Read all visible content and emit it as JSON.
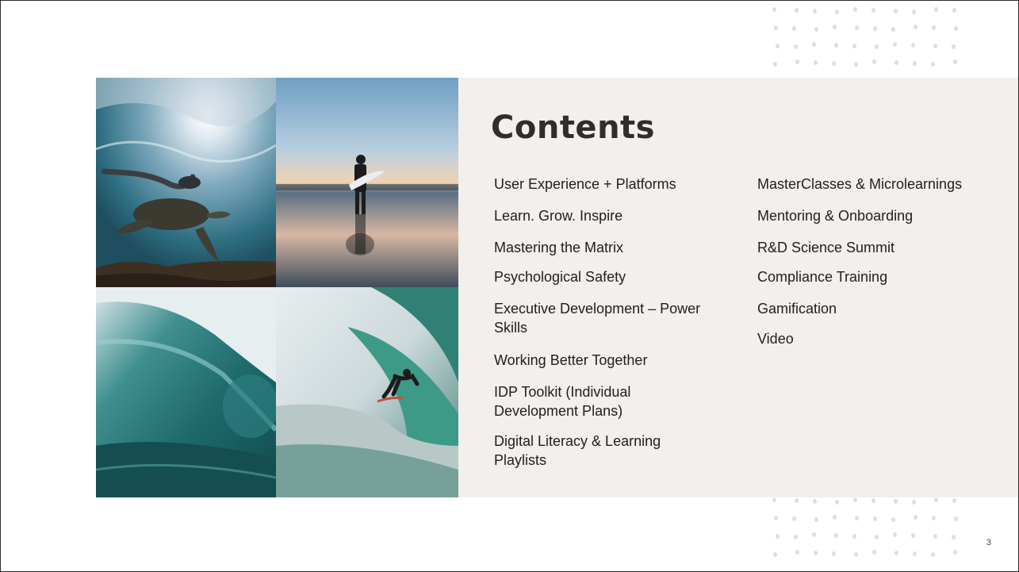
{
  "slide": {
    "title": "Contents",
    "page_number": "3",
    "contents_left": [
      "User Experience + Platforms",
      "Learn. Grow. Inspire",
      "Mastering the Matrix",
      "Psychological Safety",
      "Executive Development – Power Skills",
      "Working Better Together",
      "IDP Toolkit (Individual Development Plans)",
      "Digital Literacy & Learning Playlists"
    ],
    "contents_right": [
      "MasterClasses & Microlearnings",
      "Mentoring & Onboarding",
      "R&D Science Summit",
      "Compliance Training",
      "Gamification",
      "Video"
    ],
    "photos": [
      {
        "name": "underwater-turtle-diver-photo",
        "icon": "turtle-photo"
      },
      {
        "name": "surfer-on-beach-photo",
        "icon": "surfer-silhouette-photo"
      },
      {
        "name": "ocean-wave-photo",
        "icon": "wave-photo"
      },
      {
        "name": "surfer-in-barrel-photo",
        "icon": "surfer-barrel-photo"
      }
    ]
  },
  "colors": {
    "panel_background": "#f2efec",
    "title_text": "#2e2e2e",
    "body_text": "#1f1f1f",
    "dot_accent": "#e8dccf"
  }
}
